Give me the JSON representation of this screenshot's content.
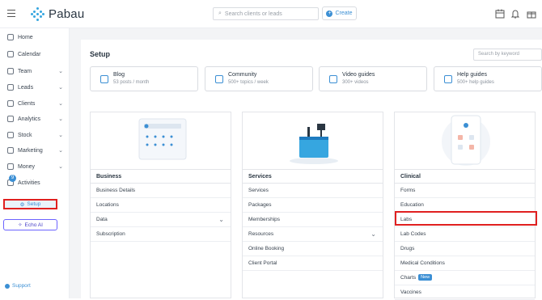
{
  "header": {
    "logo_text": "Pabau",
    "search_placeholder": "Search clients or leads",
    "create_label": "Create"
  },
  "sidebar": {
    "items": [
      {
        "label": "Home",
        "icon": "home-icon",
        "chevron": ""
      },
      {
        "label": "Calendar",
        "icon": "calendar-icon",
        "chevron": ""
      },
      {
        "label": "Team",
        "icon": "team-icon",
        "chevron": "⌄"
      },
      {
        "label": "Leads",
        "icon": "leads-icon",
        "chevron": "⌄"
      },
      {
        "label": "Clients",
        "icon": "clients-icon",
        "chevron": "⌄"
      },
      {
        "label": "Analytics",
        "icon": "analytics-icon",
        "chevron": "⌄"
      },
      {
        "label": "Stock",
        "icon": "stock-icon",
        "chevron": "⌄"
      },
      {
        "label": "Marketing",
        "icon": "marketing-icon",
        "chevron": "⌄"
      },
      {
        "label": "Money",
        "icon": "money-icon",
        "chevron": "⌄"
      },
      {
        "label": "Activities",
        "icon": "activities-icon",
        "chevron": ""
      }
    ],
    "activities_badge": "9",
    "setup_label": "Setup",
    "echo_label": "Echo AI",
    "support_label": "Support"
  },
  "main": {
    "title": "Setup",
    "keyword_placeholder": "Search by keyword",
    "cards": [
      {
        "title": "Blog",
        "sub": "53 posts / month"
      },
      {
        "title": "Community",
        "sub": "500+ topics / week"
      },
      {
        "title": "Video guides",
        "sub": "300+ videos"
      },
      {
        "title": "Help guides",
        "sub": "500+ help guides"
      }
    ],
    "columns": [
      {
        "heading": "Business",
        "rows": [
          "Business Details",
          "Locations",
          "Data",
          "Subscription"
        ]
      },
      {
        "heading": "Services",
        "rows": [
          "Services",
          "Packages",
          "Memberships",
          "Resources",
          "Online Booking",
          "Client Portal"
        ]
      },
      {
        "heading": "Clinical",
        "rows": [
          "Forms",
          "Education",
          "Labs",
          "Lab Codes",
          "Drugs",
          "Medical Conditions",
          "Charts",
          "Vaccines"
        ]
      }
    ],
    "new_badge": "New"
  },
  "colors": {
    "accent": "#3b8fd4",
    "highlight": "#e02020",
    "echo": "#6c63ff"
  }
}
